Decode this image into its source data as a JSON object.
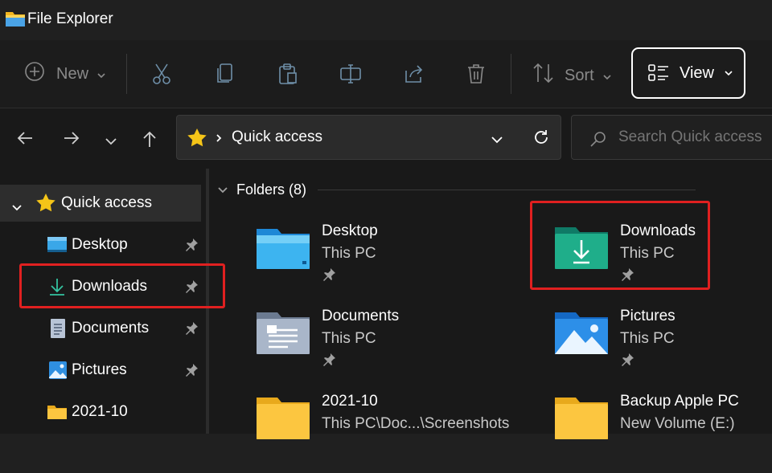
{
  "window": {
    "title": "File Explorer"
  },
  "toolbar": {
    "new_label": "New",
    "sort_label": "Sort",
    "view_label": "View"
  },
  "address": {
    "location": "Quick access"
  },
  "search": {
    "placeholder": "Search Quick access"
  },
  "sidebar": {
    "items": [
      {
        "label": "Quick access"
      },
      {
        "label": "Desktop"
      },
      {
        "label": "Downloads"
      },
      {
        "label": "Documents"
      },
      {
        "label": "Pictures"
      },
      {
        "label": "2021-10"
      }
    ]
  },
  "content": {
    "group_label": "Folders (8)",
    "folders": [
      {
        "name": "Desktop",
        "location": "This PC"
      },
      {
        "name": "Downloads",
        "location": "This PC"
      },
      {
        "name": "Documents",
        "location": "This PC"
      },
      {
        "name": "Pictures",
        "location": "This PC"
      },
      {
        "name": "2021-10",
        "location": "This PC\\Doc...\\Screenshots"
      },
      {
        "name": "Backup Apple PC",
        "location": "New Volume (E:)"
      }
    ]
  },
  "colors": {
    "highlight": "#e02020",
    "accent_view_border": "#ffffff",
    "star": "#f5c518"
  }
}
